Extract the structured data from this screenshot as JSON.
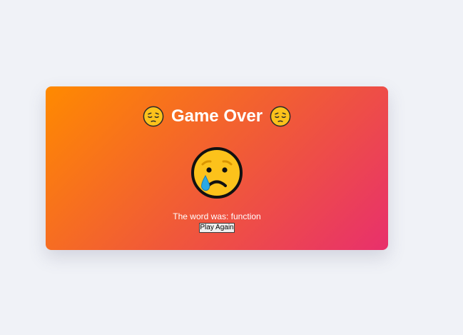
{
  "game": {
    "title": "Game Over",
    "title_emoji_icon": "pensive-face-icon",
    "status_emoji_icon": "crying-face-icon",
    "word_label": "The word was:",
    "word": "function",
    "play_again_label": "Play Again"
  },
  "colors": {
    "page_background": "#f0f2f7",
    "card_gradient_start": "#ff8a00",
    "card_gradient_end": "#e8306c",
    "text": "#ffffff"
  }
}
